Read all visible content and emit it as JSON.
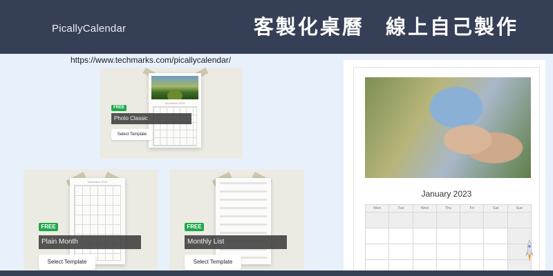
{
  "header": {
    "brand": "PicallyCalendar",
    "headline": "客製化桌曆 線上自己製作"
  },
  "url_caption": "https://www.techmarks.com/picallycalendar/",
  "templates": [
    {
      "badge": "FREE",
      "name": "Photo Classic",
      "button": "Select Template",
      "sheet_title": "November 2019"
    },
    {
      "badge": "FREE",
      "name": "Plain Month",
      "button": "Select Template",
      "sheet_title": "November 2019"
    },
    {
      "badge": "FREE",
      "name": "Monthly List",
      "button": "Select Template"
    }
  ],
  "preview": {
    "month": "January 2023",
    "weekdays": [
      "Mon",
      "Tue",
      "Wed",
      "Thu",
      "Fri",
      "Sat",
      "Sun"
    ]
  },
  "colors": {
    "header_bg": "#353f56",
    "page_bg": "#e8f0fb",
    "free_badge": "#1fa94d"
  },
  "icons": [
    "rocket-icon"
  ]
}
